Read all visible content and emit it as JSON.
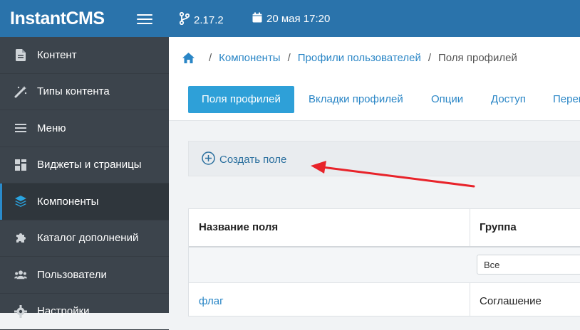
{
  "header": {
    "logo": "InstantCMS",
    "version": "2.17.2",
    "datetime": "20 мая 17:20"
  },
  "sidebar": {
    "items": [
      {
        "label": "Контент",
        "icon": "file-icon"
      },
      {
        "label": "Типы контента",
        "icon": "magic-wand-icon"
      },
      {
        "label": "Меню",
        "icon": "bars-icon"
      },
      {
        "label": "Виджеты и страницы",
        "icon": "grid-icon"
      },
      {
        "label": "Компоненты",
        "icon": "layers-icon",
        "active": true
      },
      {
        "label": "Каталог дополнений",
        "icon": "puzzle-icon"
      },
      {
        "label": "Пользователи",
        "icon": "users-icon"
      },
      {
        "label": "Настройки",
        "icon": "gear-icon"
      }
    ]
  },
  "breadcrumb": {
    "items": [
      "Компоненты",
      "Профили пользователей"
    ],
    "current": "Поля профилей"
  },
  "tabs": [
    {
      "label": "Поля профилей",
      "active": true
    },
    {
      "label": "Вкладки профилей"
    },
    {
      "label": "Опции"
    },
    {
      "label": "Доступ"
    },
    {
      "label": "Перевод"
    }
  ],
  "actions": {
    "create_field": "Создать поле"
  },
  "table": {
    "columns": [
      "Название поля",
      "Группа"
    ],
    "filter": {
      "group_value": "Все"
    },
    "rows": [
      {
        "name": "флаг",
        "group": "Соглашение"
      }
    ]
  },
  "colors": {
    "topbar": "#2a73ab",
    "sidebar": "#3c444c",
    "accent": "#2ea0d8",
    "link": "#2a86c6",
    "annotation_arrow": "#e8232a"
  }
}
